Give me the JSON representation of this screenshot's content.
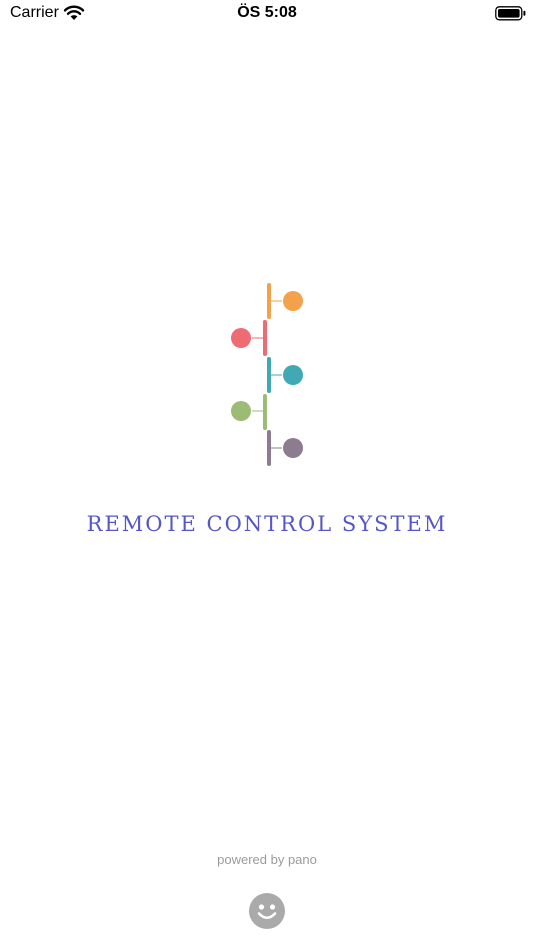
{
  "status_bar": {
    "carrier": "Carrier",
    "time": "ÖS 5:08",
    "wifi_icon": "wifi-icon",
    "battery_icon": "battery-icon"
  },
  "logo": {
    "icon": "timeline-logo-icon",
    "colors": [
      "#f3a24b",
      "#ef6b74",
      "#40a9b4",
      "#9cbb74",
      "#8d7c8f"
    ]
  },
  "title": "REMOTE CONTROL SYSTEM",
  "footer": {
    "powered_by": "powered by pano",
    "face_icon": "smiley-face-icon"
  },
  "colors": {
    "title": "#5656c6",
    "footer_text": "#9b9b9b",
    "face": "#aaaaaa"
  }
}
